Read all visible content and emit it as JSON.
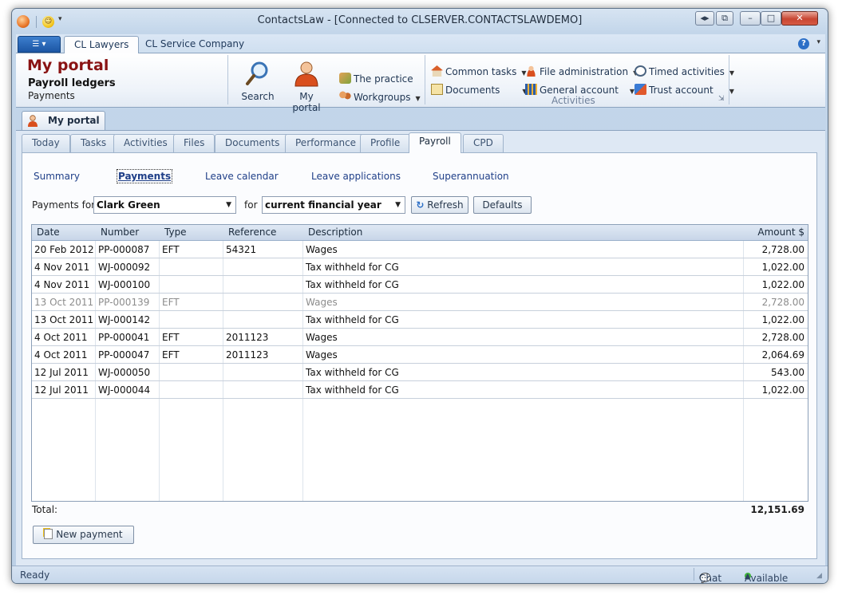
{
  "window": {
    "title": "ContactsLaw - [Connected to CLSERVER.CONTACTSLAWDEMO]"
  },
  "ribbon_tabs": [
    "CL Lawyers",
    "CL Service Company"
  ],
  "portal": {
    "title": "My portal",
    "subtitle": "Payroll ledgers",
    "subtitle2": "Payments"
  },
  "ribbon": {
    "search": "Search",
    "my_portal": "My portal",
    "the_practice": "The practice",
    "workgroups": "Workgroups",
    "common_tasks": "Common tasks",
    "documents": "Documents",
    "file_administration": "File administration",
    "general_account": "General account",
    "timed_activities": "Timed activities",
    "trust_account": "Trust account",
    "group_label": "Activities"
  },
  "doc_tab": "My portal",
  "portal_tabs": [
    "Today",
    "Tasks",
    "Activities",
    "Files",
    "Documents",
    "Performance",
    "Profile",
    "Payroll",
    "CPD"
  ],
  "active_portal_tab": "Payroll",
  "sub_nav": [
    "Summary",
    "Payments",
    "Leave calendar",
    "Leave applications",
    "Superannuation"
  ],
  "active_sub_nav": "Payments",
  "filter": {
    "payments_for_label": "Payments for",
    "employee": "Clark Green",
    "for_label": "for",
    "period": "current financial year",
    "refresh_label": "Refresh",
    "defaults_label": "Defaults"
  },
  "table": {
    "columns": [
      "Date",
      "Number",
      "Type",
      "Reference",
      "Description",
      "Amount $"
    ],
    "rows": [
      {
        "date": "20 Feb 2012",
        "number": "PP-000087",
        "type": "EFT",
        "reference": "54321",
        "description": "Wages",
        "amount": "2,728.00",
        "dim": false
      },
      {
        "date": "4 Nov 2011",
        "number": "WJ-000092",
        "type": "",
        "reference": "",
        "description": "Tax withheld for CG",
        "amount": "1,022.00",
        "dim": false
      },
      {
        "date": "4 Nov 2011",
        "number": "WJ-000100",
        "type": "",
        "reference": "",
        "description": "Tax withheld for CG",
        "amount": "1,022.00",
        "dim": false
      },
      {
        "date": "13 Oct 2011",
        "number": "PP-000139",
        "type": "EFT",
        "reference": "",
        "description": "Wages",
        "amount": "2,728.00",
        "dim": true
      },
      {
        "date": "13 Oct 2011",
        "number": "WJ-000142",
        "type": "",
        "reference": "",
        "description": "Tax withheld for CG",
        "amount": "1,022.00",
        "dim": false
      },
      {
        "date": "4 Oct 2011",
        "number": "PP-000041",
        "type": "EFT",
        "reference": "2011123",
        "description": "Wages",
        "amount": "2,728.00",
        "dim": false
      },
      {
        "date": "4 Oct 2011",
        "number": "PP-000047",
        "type": "EFT",
        "reference": "2011123",
        "description": "Wages",
        "amount": "2,064.69",
        "dim": false
      },
      {
        "date": "12 Jul 2011",
        "number": "WJ-000050",
        "type": "",
        "reference": "",
        "description": "Tax withheld for CG",
        "amount": "543.00",
        "dim": false
      },
      {
        "date": "12 Jul 2011",
        "number": "WJ-000044",
        "type": "",
        "reference": "",
        "description": "Tax withheld for CG",
        "amount": "1,022.00",
        "dim": false
      }
    ]
  },
  "total": {
    "label": "Total:",
    "value": "12,151.69"
  },
  "new_payment_label": "New payment",
  "status": {
    "text": "Ready",
    "chat": "Chat",
    "presence": "Available"
  },
  "colors": {
    "accent": "#1f3f88",
    "title_red": "#8a1313",
    "dim_row": "#8c8c8c"
  }
}
